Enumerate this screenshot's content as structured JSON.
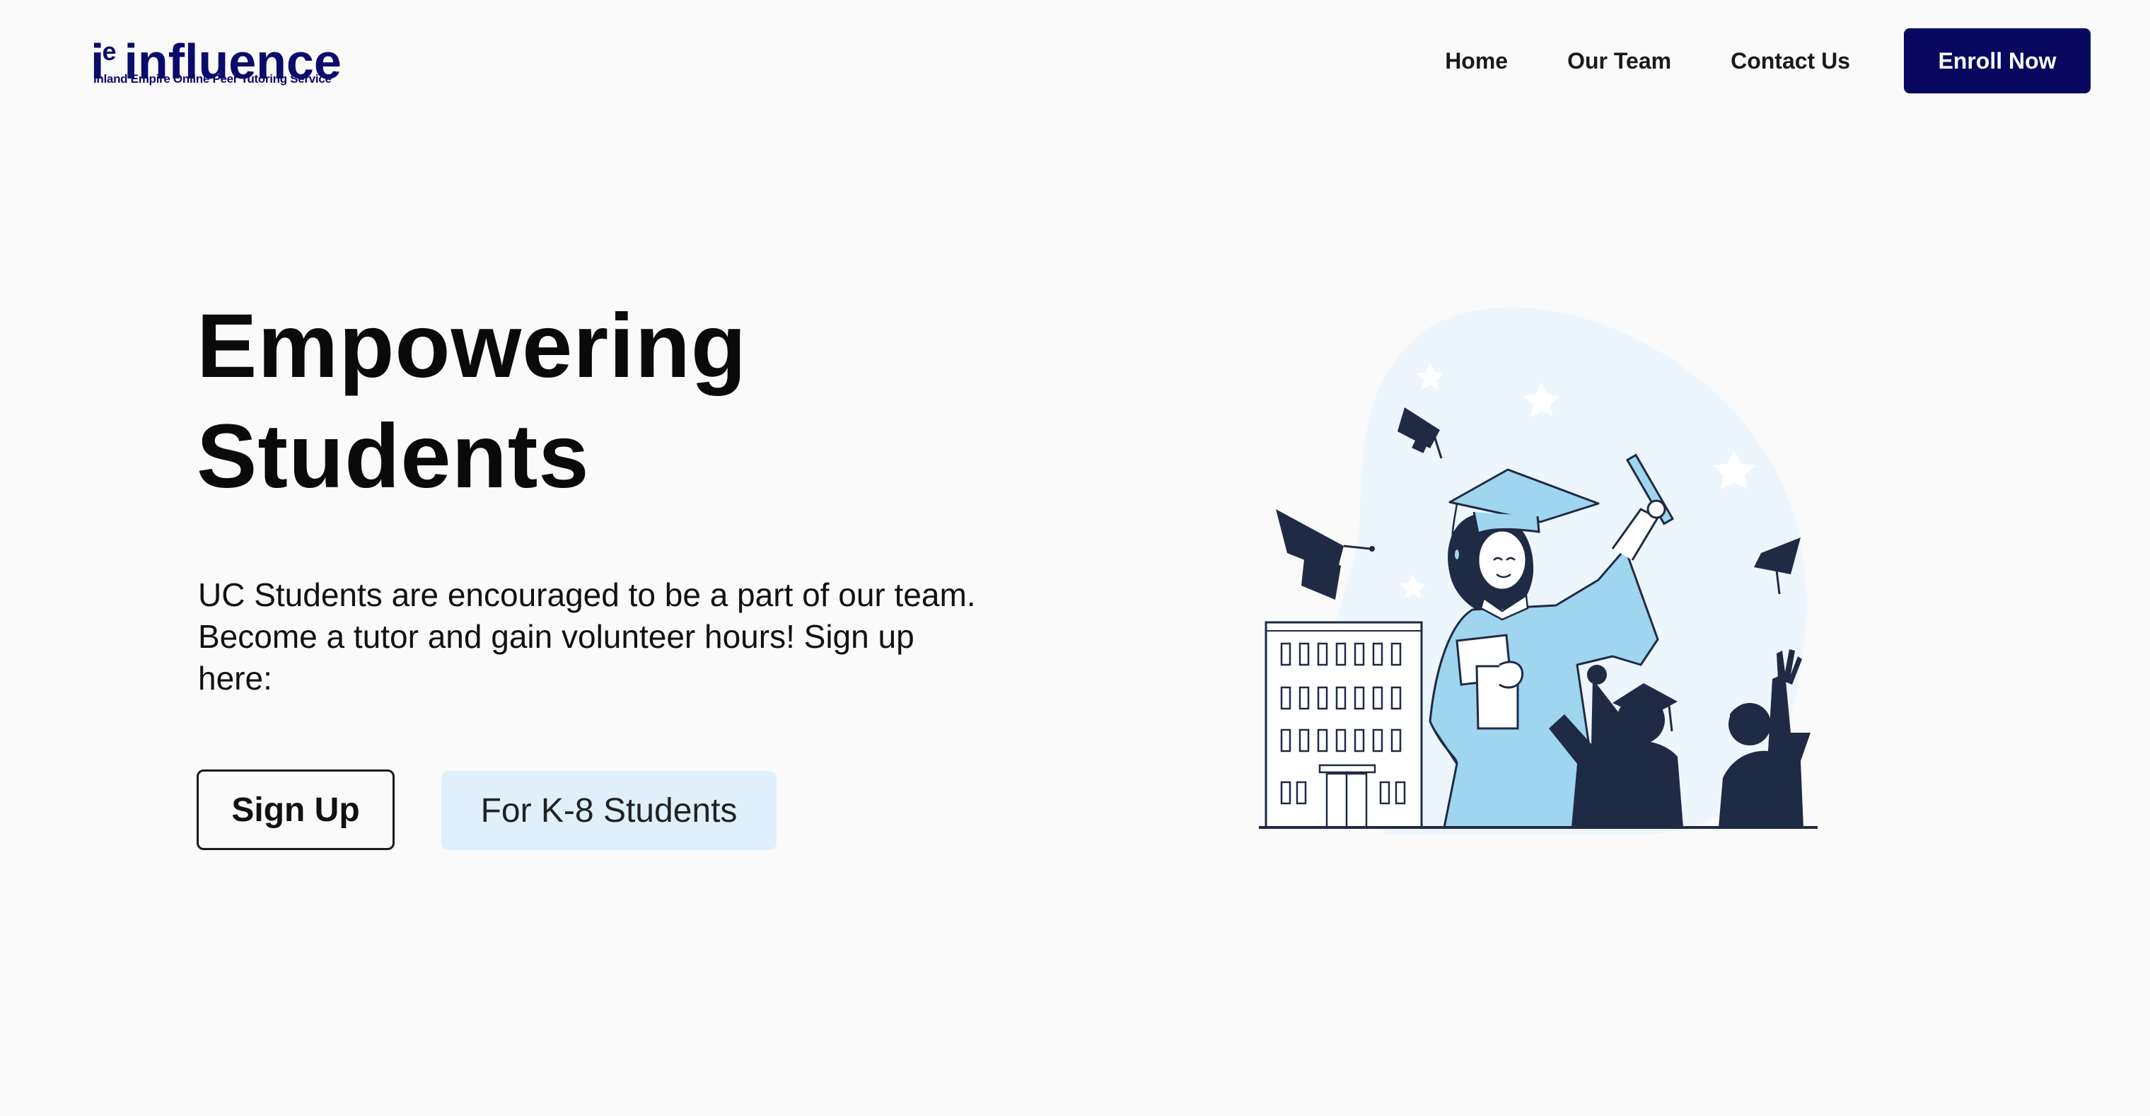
{
  "header": {
    "logo": {
      "mark": "i",
      "mark_sup": "e",
      "wordmark": "influence",
      "tagline": "Inland Empire Online Peer Tutoring Service"
    },
    "nav": [
      {
        "label": "Home"
      },
      {
        "label": "Our Team"
      },
      {
        "label": "Contact Us"
      }
    ],
    "cta_label": "Enroll Now"
  },
  "hero": {
    "title_line1": "Empowering",
    "title_line2": "Students",
    "description": "UC Students are encouraged to be a part of our team. Become a tutor and gain volunteer hours! Sign up here:",
    "primary_button": "Sign Up",
    "secondary_button": "For K-8 Students"
  },
  "colors": {
    "brand_navy": "#08085e",
    "logo_navy": "#0b0b6b",
    "page_background": "#fafafa",
    "secondary_button_bg": "#dff0fb",
    "illustration_blue": "#9fd5ef",
    "illustration_dark": "#1f2a44"
  },
  "icons": {
    "illustration": "graduation-illustration"
  }
}
